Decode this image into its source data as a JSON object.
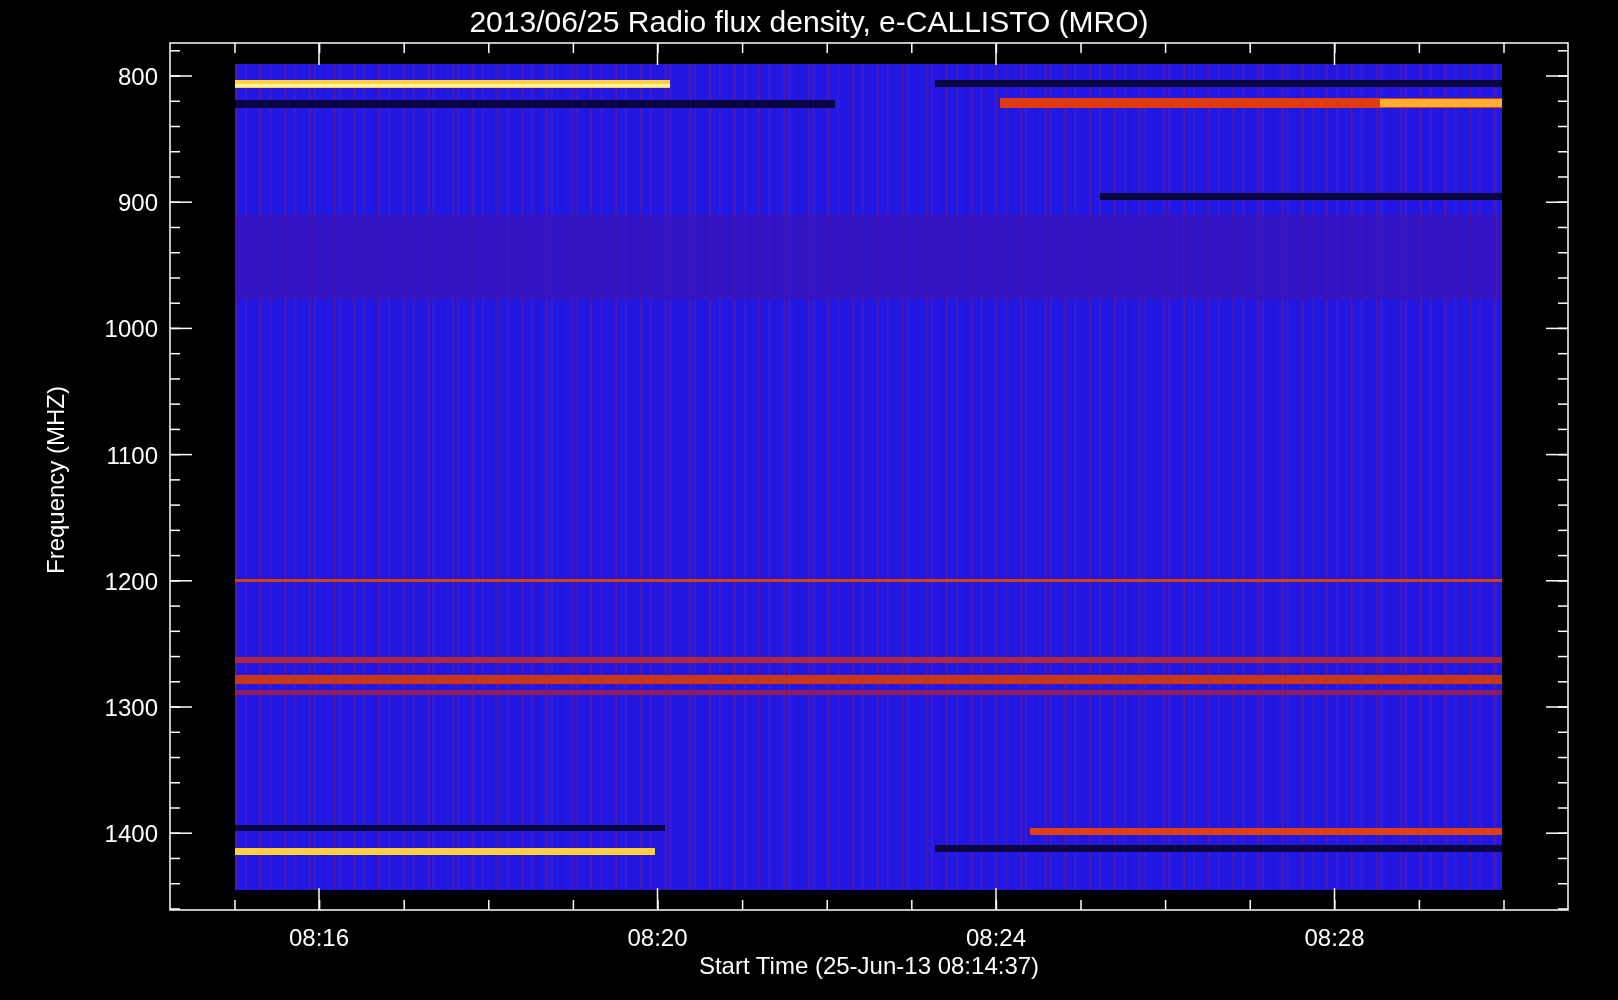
{
  "plot": {
    "title": "2013/06/25  Radio flux density, e-CALLISTO (MRO)",
    "ylabel": "Frequency (MHZ)",
    "xlabel": "Start Time (25-Jun-13 08:14:37)",
    "y_tick_labels": [
      "800",
      "900",
      "1000",
      "1100",
      "1200",
      "1300",
      "1400"
    ],
    "x_tick_labels": [
      "08:16",
      "08:20",
      "08:24",
      "08:28"
    ]
  }
}
